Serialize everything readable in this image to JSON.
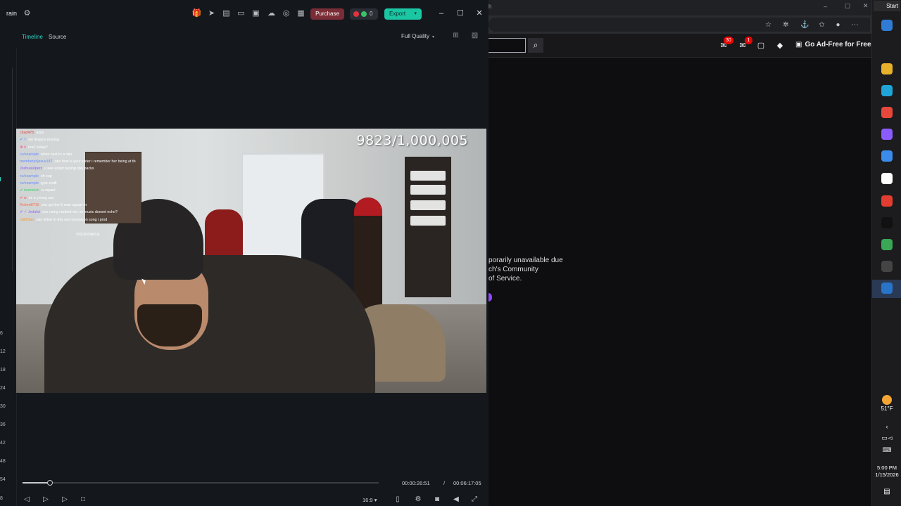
{
  "editor": {
    "app_title": "rain",
    "purchase_label": "Purchase",
    "points_value": "0",
    "export_label": "Export",
    "tabs": [
      {
        "label": "Timeline",
        "color": "#2fd2c1"
      },
      {
        "label": "Source",
        "color": "#cfd2d6"
      }
    ],
    "quality_label": "Full Quality",
    "ruler_labels": [
      "6",
      "12",
      "18",
      "24",
      "30",
      "36",
      "42",
      "48",
      "54",
      "8"
    ],
    "video": {
      "counter_text": "9823/1,000,005",
      "chat_lines": [
        {
          "user": "chad475",
          "user_color": "#e04a4a",
          "text": "ayyy"
        },
        {
          "user": "✔ T",
          "user_color": "#4fa3ff",
          "text": "aw doggos playing"
        },
        {
          "user": "❖ h",
          "user_color": "#ff5a9d",
          "text": "ma2 today?"
        },
        {
          "user": "cc/example",
          "user_color": "#6a8cff",
          "text": "whos next to a rain"
        },
        {
          "user": "memberat/jesus187",
          "user_color": "#6a8cff",
          "text": "rain how is your sister i remember her being at the late house"
        },
        {
          "user": "JoshuaViperz",
          "user_color": "#8a5cff",
          "text": "u see adapt buying nba packs"
        },
        {
          "user": "cc/example",
          "user_color": "#6a8cff",
          "text": "oh sup"
        },
        {
          "user": "cc/example",
          "user_color": "#6a8cff",
          "text": "type xndlt"
        },
        {
          "user": "✔ rizzzlovin",
          "user_color": "#3ecf6a",
          "text": "w squad"
        },
        {
          "user": "✔ w",
          "user_color": "#ff5a5a",
          "text": "im a young unc"
        },
        {
          "user": "Robert8715",
          "user_color": "#ff6a4a",
          "text": "you got the 5 man squad rn"
        },
        {
          "user": "✔ ✓ Jedafal",
          "user_color": "#9c6aff",
          "text": "you using cardiod mic so music doesnt echo?"
        },
        {
          "user": "ndl02fan",
          "user_color": "#ff9a2a",
          "text": "rain listen to this one toomason song i prod"
        }
      ],
      "chat_banner": "VISCA BARCA"
    },
    "playback": {
      "progress_fraction": 0.077,
      "current_time": "00:00:26:51",
      "separator": "/",
      "total_time": "00:06:17:05",
      "aspect_ratio": "16:9"
    }
  },
  "browser": {
    "title_fragment": "h",
    "notif_badge": "30",
    "inbox_badge": "1",
    "adfree_label": "Go Ad-Free for Free",
    "unavailable_lines": [
      "porarily unavailable due",
      "ch's Community",
      "of Service."
    ]
  },
  "taskbar": {
    "start_label": "Start",
    "temperature": "51°F",
    "time": "5:00 PM",
    "date": "1/15/2026",
    "app_colors": [
      "#2f7bd6",
      "#e8b12a",
      "#1fa5d8",
      "#e8483b",
      "#8a5cff",
      "#3b8bea",
      "#ffffff",
      "#e23d30",
      "#111111",
      "#3aa757",
      "#444444",
      "#2874c9",
      "#1f6fd0"
    ]
  }
}
